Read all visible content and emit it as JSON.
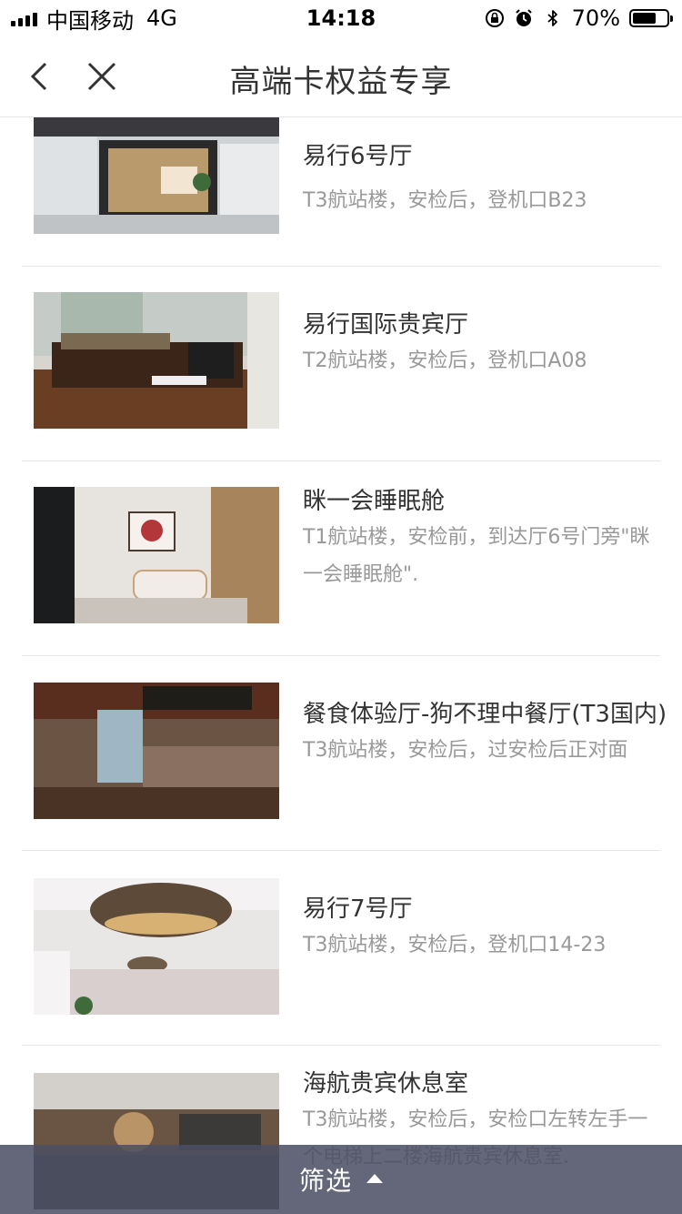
{
  "status_bar": {
    "carrier": "中国移动",
    "network": "4G",
    "time": "14:18",
    "battery_percent": "70%",
    "battery_level": 0.7,
    "icons": [
      "orientation-lock-icon",
      "alarm-icon",
      "bluetooth-icon"
    ]
  },
  "nav": {
    "title": "高端卡权益专享",
    "back_icon": "chevron-left-icon",
    "close_icon": "close-icon"
  },
  "lounges": [
    {
      "title": "易行6号厅",
      "desc": "T3航站楼，安检后，登机口B23"
    },
    {
      "title": "易行国际贵宾厅",
      "desc": "T2航站楼，安检后，登机口A08"
    },
    {
      "title": "眯一会睡眠舱",
      "desc": "T1航站楼，安检前，到达厅6号门旁\"眯一会睡眠舱\"."
    },
    {
      "title": "餐食体验厅-狗不理中餐厅(T3国内)",
      "desc": "T3航站楼，安检后，过安检后正对面"
    },
    {
      "title": "易行7号厅",
      "desc": "T3航站楼，安检后，登机口14-23"
    },
    {
      "title": "海航贵宾休息室",
      "desc": "T3航站楼，安检后，安检口左转左手一个电梯上二楼海航贵宾休息室."
    }
  ],
  "filter": {
    "label": "筛选",
    "icon": "triangle-up-icon"
  },
  "colors": {
    "filter_bar": "#4a4e63",
    "title_text": "#333333",
    "desc_text": "#999999",
    "divider": "#e6e6e6"
  }
}
